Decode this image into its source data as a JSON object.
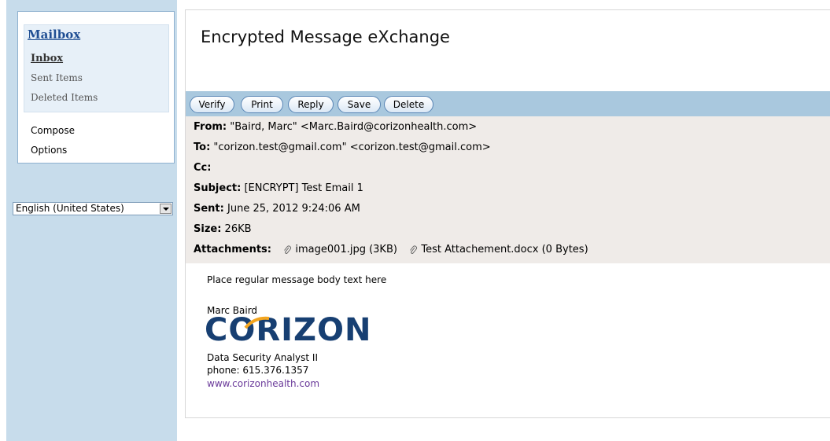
{
  "sidebar": {
    "mailbox_title": "Mailbox",
    "folders": [
      "Inbox",
      "Sent Items",
      "Deleted Items"
    ],
    "links": [
      "Compose",
      "Options"
    ],
    "language": "English (United States)"
  },
  "main": {
    "title": "Encrypted Message eXchange",
    "toolbar": [
      "Verify",
      "Print",
      "Reply",
      "Save",
      "Delete"
    ]
  },
  "message": {
    "from_label": "From:",
    "from": "\"Baird, Marc\" <Marc.Baird@corizonhealth.com>",
    "to_label": "To:",
    "to": "\"corizon.test@gmail.com\" <corizon.test@gmail.com>",
    "cc_label": "Cc:",
    "cc": "",
    "subject_label": "Subject:",
    "subject": "[ENCRYPT] Test Email 1",
    "sent_label": "Sent:",
    "sent": "June 25, 2012 9:24:06 AM",
    "size_label": "Size:",
    "size": "26KB",
    "attachments_label": "Attachments:",
    "attachments": [
      "image001.jpg (3KB)",
      "Test Attachement.docx (0 Bytes)"
    ]
  },
  "body": {
    "text": "Place regular message body text here",
    "sig_name": "Marc Baird",
    "logo": "CORIZON",
    "sig_title": "Data Security Analyst II",
    "sig_phone": "phone: 615.376.1357",
    "sig_url": "www.corizonhealth.com"
  },
  "colors": {
    "sidebar_bg": "#c7dceb",
    "toolbar_bg": "#a9c8de",
    "header_bg": "#efebe8",
    "link": "#1f4e93",
    "logo": "#173f72",
    "logo_accent": "#f3a51f"
  }
}
